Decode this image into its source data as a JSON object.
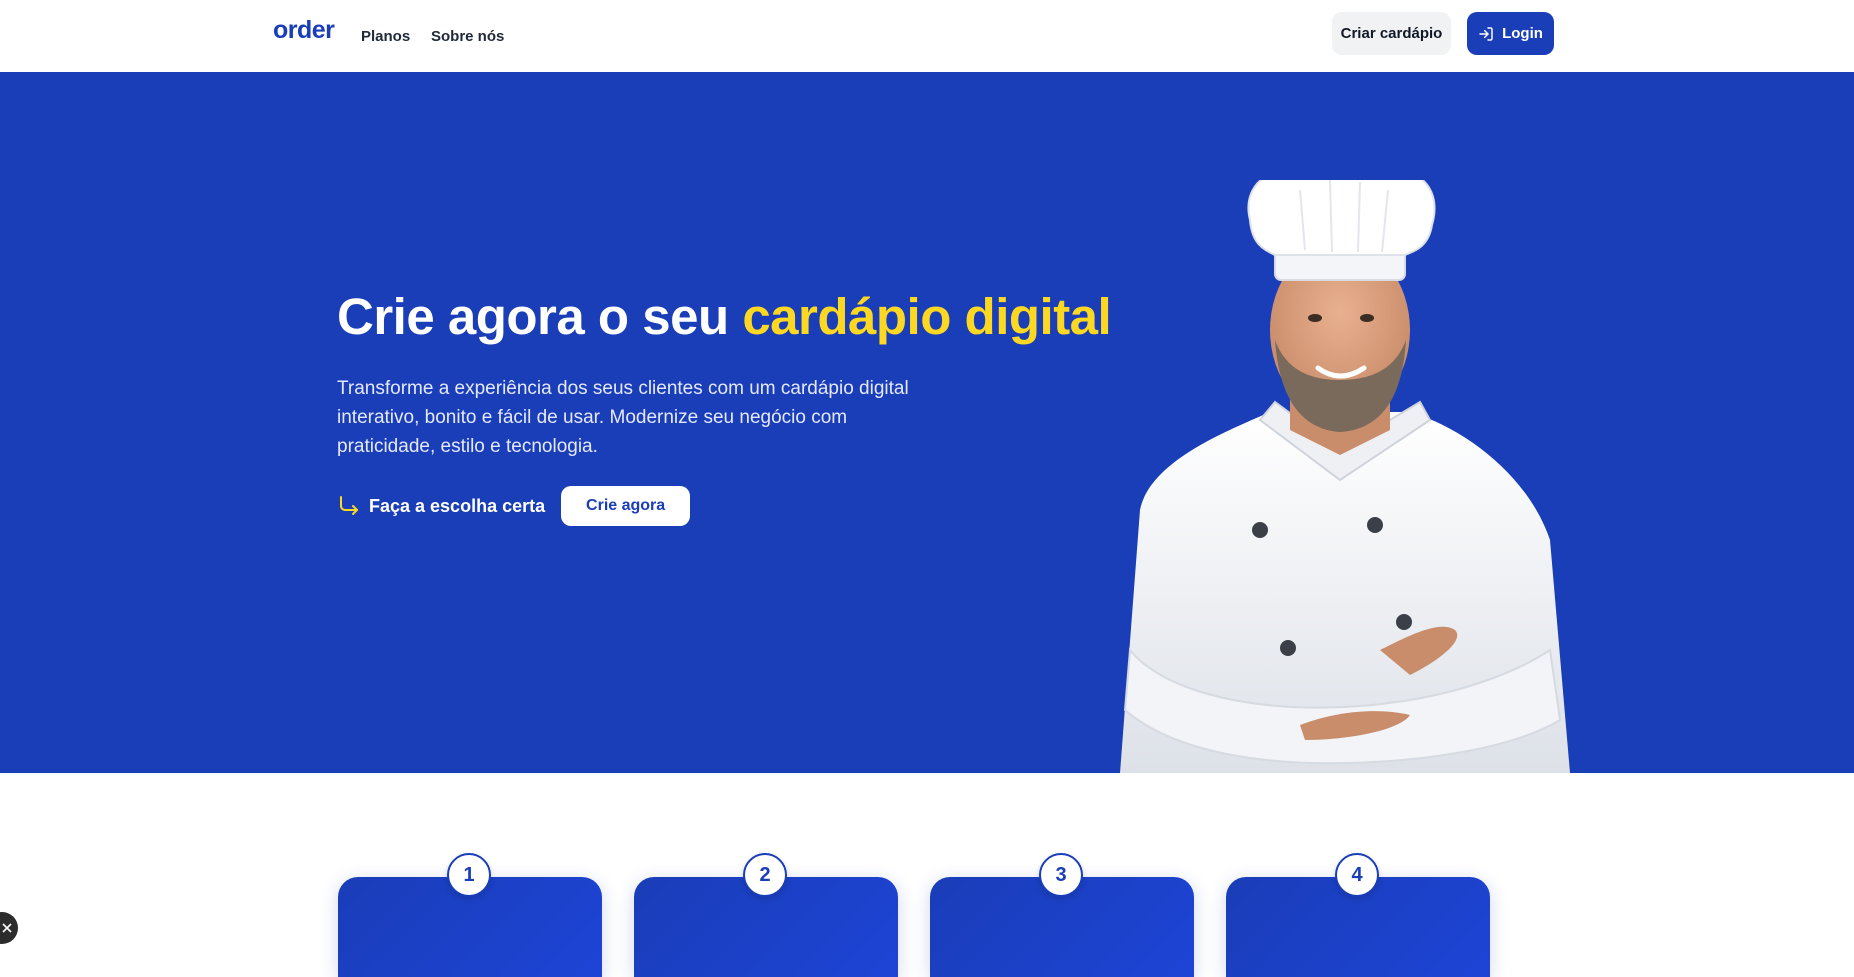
{
  "header": {
    "logo": "order",
    "nav": [
      "Planos",
      "Sobre nós"
    ],
    "create_button": "Criar cardápio",
    "login_button": "Login",
    "login_icon": "login-icon"
  },
  "hero": {
    "title_main": "Crie agora o seu ",
    "title_highlight": "cardápio digital",
    "description": "Transforme a experiência dos seus clientes com um cardápio digital interativo, bonito e fácil de usar. Modernize seu negócio com praticidade, estilo e tecnologia.",
    "cta_text": "Faça a escolha certa",
    "cta_button": "Crie agora",
    "colors": {
      "background": "#1a3db8",
      "highlight": "#fcd823"
    }
  },
  "steps": [
    "1",
    "2",
    "3",
    "4"
  ]
}
